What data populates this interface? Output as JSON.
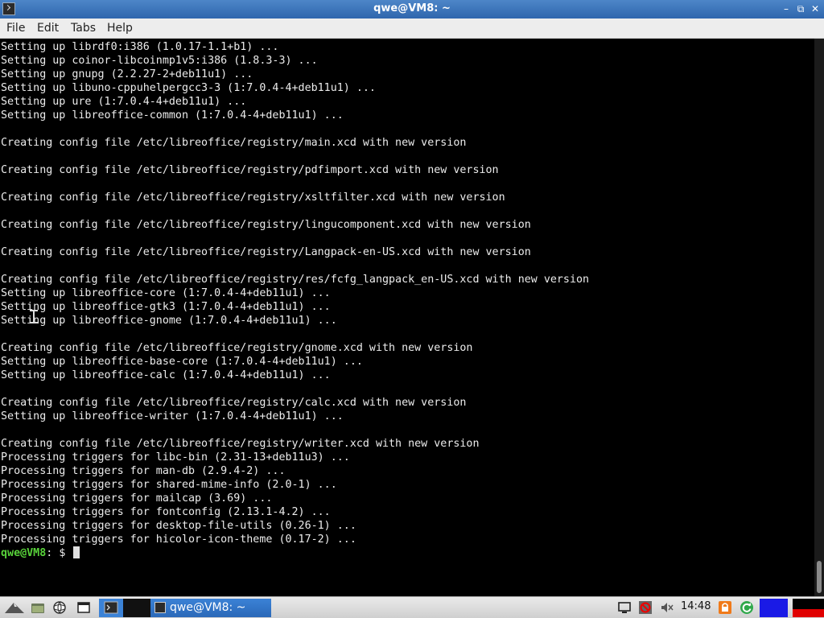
{
  "window": {
    "title": "qwe@VM8: ~",
    "controls": {
      "minimize": "–",
      "maximize": "⧉",
      "close": "✕"
    }
  },
  "menu": [
    "File",
    "Edit",
    "Tabs",
    "Help"
  ],
  "terminal": {
    "lines": [
      "Setting up librdf0:i386 (1.0.17-1.1+b1) ...",
      "Setting up coinor-libcoinmp1v5:i386 (1.8.3-3) ...",
      "Setting up gnupg (2.2.27-2+deb11u1) ...",
      "Setting up libuno-cppuhelpergcc3-3 (1:7.0.4-4+deb11u1) ...",
      "Setting up ure (1:7.0.4-4+deb11u1) ...",
      "Setting up libreoffice-common (1:7.0.4-4+deb11u1) ...",
      "",
      "Creating config file /etc/libreoffice/registry/main.xcd with new version",
      "",
      "Creating config file /etc/libreoffice/registry/pdfimport.xcd with new version",
      "",
      "Creating config file /etc/libreoffice/registry/xsltfilter.xcd with new version",
      "",
      "Creating config file /etc/libreoffice/registry/lingucomponent.xcd with new version",
      "",
      "Creating config file /etc/libreoffice/registry/Langpack-en-US.xcd with new version",
      "",
      "Creating config file /etc/libreoffice/registry/res/fcfg_langpack_en-US.xcd with new version",
      "Setting up libreoffice-core (1:7.0.4-4+deb11u1) ...",
      "Setting up libreoffice-gtk3 (1:7.0.4-4+deb11u1) ...",
      "Setting up libreoffice-gnome (1:7.0.4-4+deb11u1) ...",
      "",
      "Creating config file /etc/libreoffice/registry/gnome.xcd with new version",
      "Setting up libreoffice-base-core (1:7.0.4-4+deb11u1) ...",
      "Setting up libreoffice-calc (1:7.0.4-4+deb11u1) ...",
      "",
      "Creating config file /etc/libreoffice/registry/calc.xcd with new version",
      "Setting up libreoffice-writer (1:7.0.4-4+deb11u1) ...",
      "",
      "Creating config file /etc/libreoffice/registry/writer.xcd with new version",
      "Processing triggers for libc-bin (2.31-13+deb11u3) ...",
      "Processing triggers for man-db (2.9.4-2) ...",
      "Processing triggers for shared-mime-info (2.0-1) ...",
      "Processing triggers for mailcap (3.69) ...",
      "Processing triggers for fontconfig (2.13.1-4.2) ...",
      "Processing triggers for desktop-file-utils (0.26-1) ...",
      "Processing triggers for hicolor-icon-theme (0.17-2) ..."
    ],
    "prompt_user": "qwe@VM8",
    "prompt_rest": ": $ "
  },
  "taskbar": {
    "task_label": "qwe@VM8: ~",
    "clock": "14:48",
    "icons": [
      "app-menu-icon",
      "file-manager-icon",
      "web-browser-icon",
      "show-desktop-icon",
      "terminal-launcher-icon",
      "display-icon",
      "network-blocked-icon",
      "volume-muted-icon",
      "lock-icon",
      "update-icon"
    ]
  },
  "colors": {
    "titlebar": "#3a73bb",
    "prompt_user": "#58d23a",
    "terminal_bg": "#000000",
    "terminal_fg": "#ececec",
    "task_active": "#2f70c4",
    "tray_blue": "#1a1ae6",
    "tray_red": "#e00000"
  }
}
